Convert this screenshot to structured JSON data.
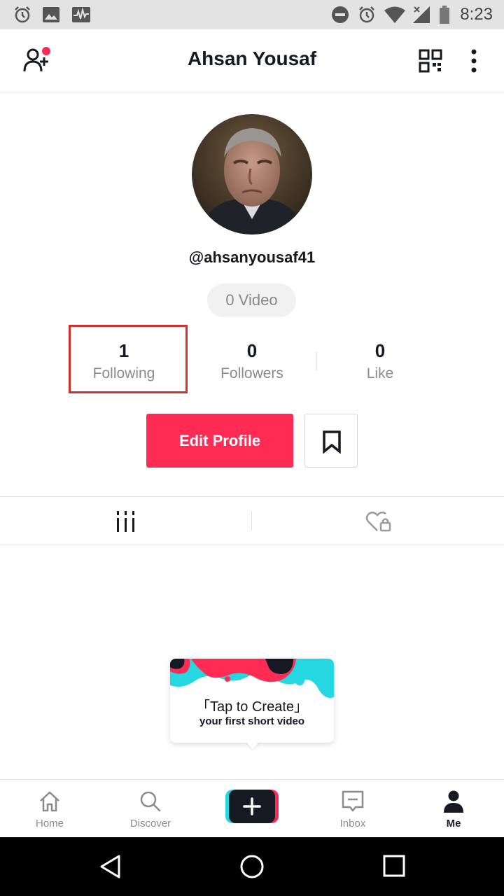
{
  "status_bar": {
    "time": "8:23",
    "icons": [
      "alarm-icon",
      "image-icon",
      "activity-icon",
      "dnd-icon",
      "alarm-icon",
      "wifi-icon",
      "signal-icon",
      "battery-icon"
    ]
  },
  "header": {
    "title": "Ahsan Yousaf",
    "icons": [
      "add-friend-icon",
      "qr-code-icon",
      "more-vertical-icon"
    ]
  },
  "profile": {
    "username": "@ahsanyousaf41",
    "video_count": "0 Video"
  },
  "stats": {
    "following": {
      "count": "1",
      "label": "Following"
    },
    "followers": {
      "count": "0",
      "label": "Followers"
    },
    "likes": {
      "count": "0",
      "label": "Like"
    }
  },
  "actions": {
    "edit_profile_label": "Edit Profile",
    "bookmark_icon": "bookmark-icon"
  },
  "tabs": [
    "grid-icon",
    "liked-locked-icon"
  ],
  "tooltip": {
    "title": "「Tap to Create」",
    "subtitle": "your first short video"
  },
  "bottom_nav": {
    "home": "Home",
    "discover": "Discover",
    "inbox": "Inbox",
    "me": "Me"
  },
  "colors": {
    "accent": "#fe2c55",
    "cyan": "#25f4ee",
    "highlight_box": "#d32f2f",
    "status_bar": "#e3e3e3"
  }
}
